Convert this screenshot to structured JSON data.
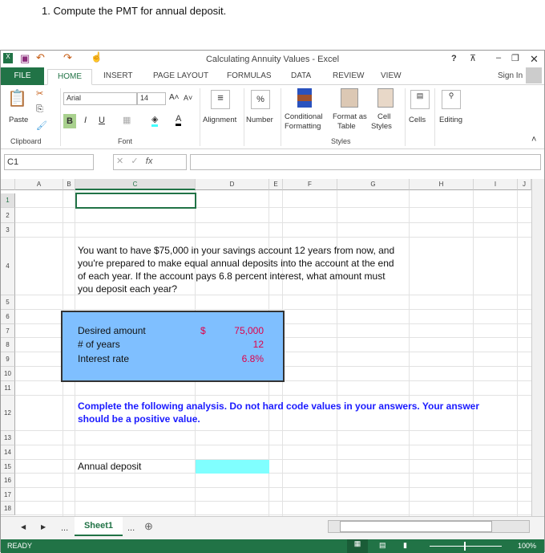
{
  "question": "1. Compute the PMT for annual deposit.",
  "title": "Calculating Annuity Values - Excel",
  "window_controls": {
    "help": "?",
    "minimize": "–",
    "restore": "❐",
    "close": "✕"
  },
  "tabs": [
    "FILE",
    "HOME",
    "INSERT",
    "PAGE LAYOUT",
    "FORMULAS",
    "DATA",
    "REVIEW",
    "VIEW"
  ],
  "sign_in": "Sign In",
  "ribbon": {
    "paste": "Paste",
    "font_name": "Arial",
    "font_size": "14",
    "bold": "B",
    "italic": "I",
    "underline": "U",
    "alignment": "Alignment",
    "number": "Number",
    "percent": "%",
    "conditional": "Conditional",
    "formatting": "Formatting",
    "format_as": "Format as",
    "table": "Table",
    "cell": "Cell",
    "styles_btn": "Styles",
    "cells": "Cells",
    "editing": "Editing",
    "groups": [
      "Clipboard",
      "Font",
      "Styles"
    ]
  },
  "name_box": "C1",
  "fx": "fx",
  "formula": "",
  "columns": [
    "A",
    "B",
    "C",
    "D",
    "E",
    "F",
    "G",
    "H",
    "I",
    "J"
  ],
  "rows": [
    "1",
    "2",
    "3",
    "4",
    "5",
    "6",
    "7",
    "8",
    "9",
    "10",
    "11",
    "12",
    "13",
    "14",
    "15",
    "16",
    "17",
    "18"
  ],
  "cells": {
    "problem": "You want to have $75,000 in your savings account 12 years from now, and you're prepared to make equal annual deposits into the account at the end of each year. If the account pays 6.8 percent interest, what amount must you deposit each year?",
    "desired_label": "Desired amount",
    "desired_cur": "$",
    "desired_value": "75,000",
    "years_label": "# of years",
    "years_value": "12",
    "rate_label": "Interest rate",
    "rate_value": "6.8%",
    "instructions": "Complete the following analysis. Do not hard code values in your answers. Your answer should be a positive value.",
    "annual_label": "Annual deposit",
    "annual_value": ""
  },
  "sheet_tab": "Sheet1",
  "ellipsis": "...",
  "status": "READY",
  "zoom": "100%",
  "colors": {
    "excel_green": "#217346",
    "input_box": "#7fbfff",
    "answer_cell": "#80ffff",
    "value_red": "#e0004a",
    "instruction_blue": "#1a1aff"
  }
}
